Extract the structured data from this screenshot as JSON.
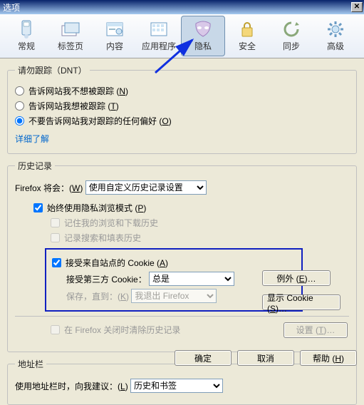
{
  "window": {
    "title": "选项"
  },
  "tabs": {
    "general": "常规",
    "tabs": "标签页",
    "content": "内容",
    "apps": "应用程序",
    "privacy": "隐私",
    "security": "安全",
    "sync": "同步",
    "advanced": "高级"
  },
  "dnt": {
    "legend": "请勿跟踪（DNT）",
    "opt1a": "告诉网站我不想被跟踪 (",
    "opt1b": ")",
    "opt1k": "N",
    "opt2a": "告诉网站我想被跟踪 (",
    "opt2b": ")",
    "opt2k": "T",
    "opt3a": "不要告诉网站我对跟踪的任何偏好 (",
    "opt3b": ")",
    "opt3k": "O",
    "more": "详细了解"
  },
  "history": {
    "legend": "历史记录",
    "rowLabelA": "Firefox 将会：(",
    "rowKey": "W",
    "rowLabelB": ")",
    "mode": "使用自定义历史记录设置",
    "alwaysPrivateA": "始终使用隐私浏览模式 (",
    "alwaysPrivateKey": "P",
    "alwaysPrivateB": ")",
    "remember": "记住我的浏览和下载历史",
    "searchForm": "记录搜索和填表历史",
    "acceptCookiesA": "接受来自站点的 Cookie (",
    "acceptCookiesKey": "A",
    "acceptCookiesB": ")",
    "thirdParty": "接受第三方 Cookie：",
    "thirdPartyValue": "总是",
    "keepUntilA": "保存，直到：(",
    "keepUntilKey": "K",
    "keepUntilB": ")",
    "keepUntilValue": "我退出 Firefox",
    "clearOnClose": "在 Firefox 关闭时清除历史记录",
    "exceptionsA": "例外 (",
    "exceptionsKey": "E",
    "exceptionsB": ")…",
    "showCookiesA": "显示 Cookie (",
    "showCookiesKey": "S",
    "showCookiesB": ")…",
    "settingsA": "设置 (",
    "settingsKey": "T",
    "settingsB": ")…"
  },
  "location": {
    "legend": "地址栏",
    "labelA": "使用地址栏时，向我建议：(",
    "labelKey": "L",
    "labelB": ")",
    "value": "历史和书签"
  },
  "footer": {
    "ok": "确定",
    "cancel": "取消",
    "helpA": "帮助 (",
    "helpB": ")",
    "helpKey": "H"
  }
}
